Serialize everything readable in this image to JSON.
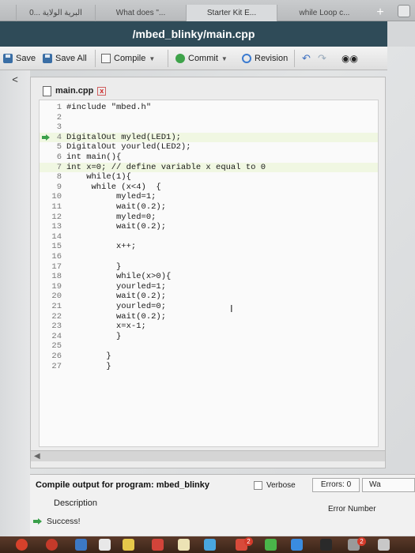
{
  "browser": {
    "tabs": [
      {
        "label": "0... البرية الولاية"
      },
      {
        "label": "What does \"..."
      },
      {
        "label": "Starter Kit E..."
      },
      {
        "label": "while Loop c..."
      }
    ],
    "new_tab_label": "+"
  },
  "header": {
    "title": "/mbed_blinky/main.cpp"
  },
  "toolbar": {
    "save_label": "Save",
    "save_all_label": "Save All",
    "compile_label": "Compile",
    "commit_label": "Commit",
    "revision_label": "Revision"
  },
  "sidebar": {
    "collapse_label": "<"
  },
  "editor": {
    "file_tab": "main.cpp",
    "close_label": "x",
    "lines": [
      {
        "num": "1",
        "text": "#include \"mbed.h\""
      },
      {
        "num": "2",
        "text": ""
      },
      {
        "num": "3",
        "text": ""
      },
      {
        "num": "4",
        "text": "DigitalOut myled(LED1);"
      },
      {
        "num": "5",
        "text": "DigitalOut yourled(LED2);"
      },
      {
        "num": "6",
        "text": "int main(){"
      },
      {
        "num": "7",
        "text": "int x=0; // define variable x equal to 0"
      },
      {
        "num": "8",
        "text": "    while(1){"
      },
      {
        "num": "9",
        "text": "     while (x<4)  {"
      },
      {
        "num": "10",
        "text": "          myled=1;"
      },
      {
        "num": "11",
        "text": "          wait(0.2);"
      },
      {
        "num": "12",
        "text": "          myled=0;"
      },
      {
        "num": "13",
        "text": "          wait(0.2);"
      },
      {
        "num": "14",
        "text": ""
      },
      {
        "num": "15",
        "text": "          x++;"
      },
      {
        "num": "16",
        "text": ""
      },
      {
        "num": "17",
        "text": "          }"
      },
      {
        "num": "18",
        "text": "          while(x>0){"
      },
      {
        "num": "19",
        "text": "          yourled=1;"
      },
      {
        "num": "20",
        "text": "          wait(0.2);"
      },
      {
        "num": "21",
        "text": "          yourled=0;"
      },
      {
        "num": "22",
        "text": "          wait(0.2);"
      },
      {
        "num": "23",
        "text": "          x=x-1;"
      },
      {
        "num": "24",
        "text": "          }"
      },
      {
        "num": "25",
        "text": ""
      },
      {
        "num": "26",
        "text": "        }"
      },
      {
        "num": "27",
        "text": "        }"
      }
    ]
  },
  "output": {
    "title": "Compile output for program: mbed_blinky",
    "verbose_label": "Verbose",
    "errors_label": "Errors: 0",
    "warnings_label": "Wa",
    "description_header": "Description",
    "error_number_header": "Error Number",
    "message": "Success!"
  },
  "dock": {
    "badge_1": "2",
    "badge_2": "2"
  },
  "colors": {
    "titlebar": "#2f4b58",
    "highlight_line": "#f0f7e2",
    "success_arrow": "#3aa04a"
  }
}
